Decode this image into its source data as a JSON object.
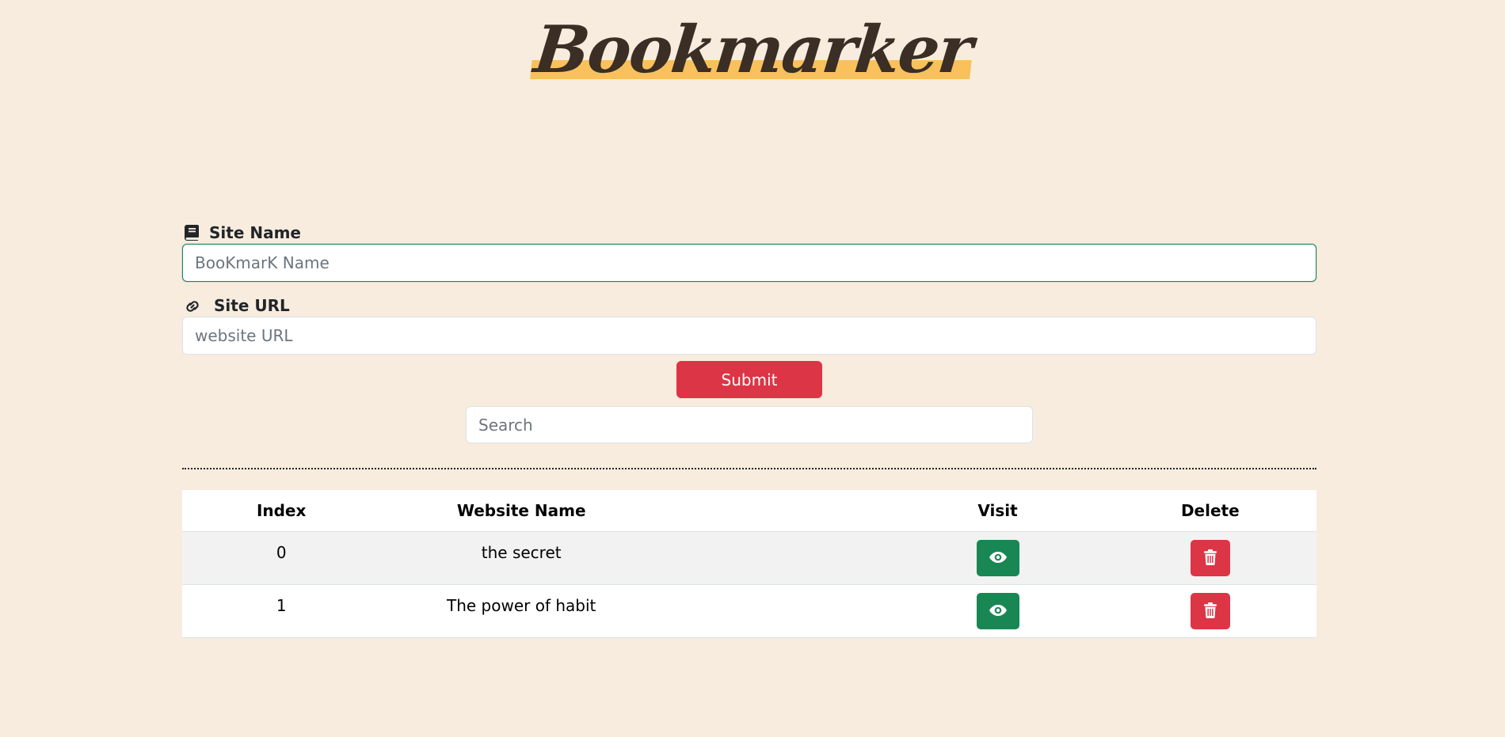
{
  "header": {
    "title": "Bookmarker"
  },
  "form": {
    "site_name_label": "Site Name",
    "site_name_placeholder": "BooKmarK Name",
    "site_name_value": "",
    "site_url_label": "Site URL",
    "site_url_placeholder": "website URL",
    "site_url_value": "",
    "submit_label": "Submit",
    "search_placeholder": "Search",
    "search_value": ""
  },
  "table": {
    "headers": {
      "index": "Index",
      "name": "Website Name",
      "visit": "Visit",
      "delete": "Delete"
    },
    "rows": [
      {
        "index": "0",
        "name": "the secret"
      },
      {
        "index": "1",
        "name": "The power of habit"
      }
    ]
  },
  "icons": {
    "site_name": "book-icon",
    "site_url": "link-icon",
    "visit": "eye-icon",
    "delete": "trash-icon"
  },
  "colors": {
    "background": "#f8ecdf",
    "title_highlight": "#f9c15c",
    "danger": "#dc3545",
    "success": "#198754"
  }
}
